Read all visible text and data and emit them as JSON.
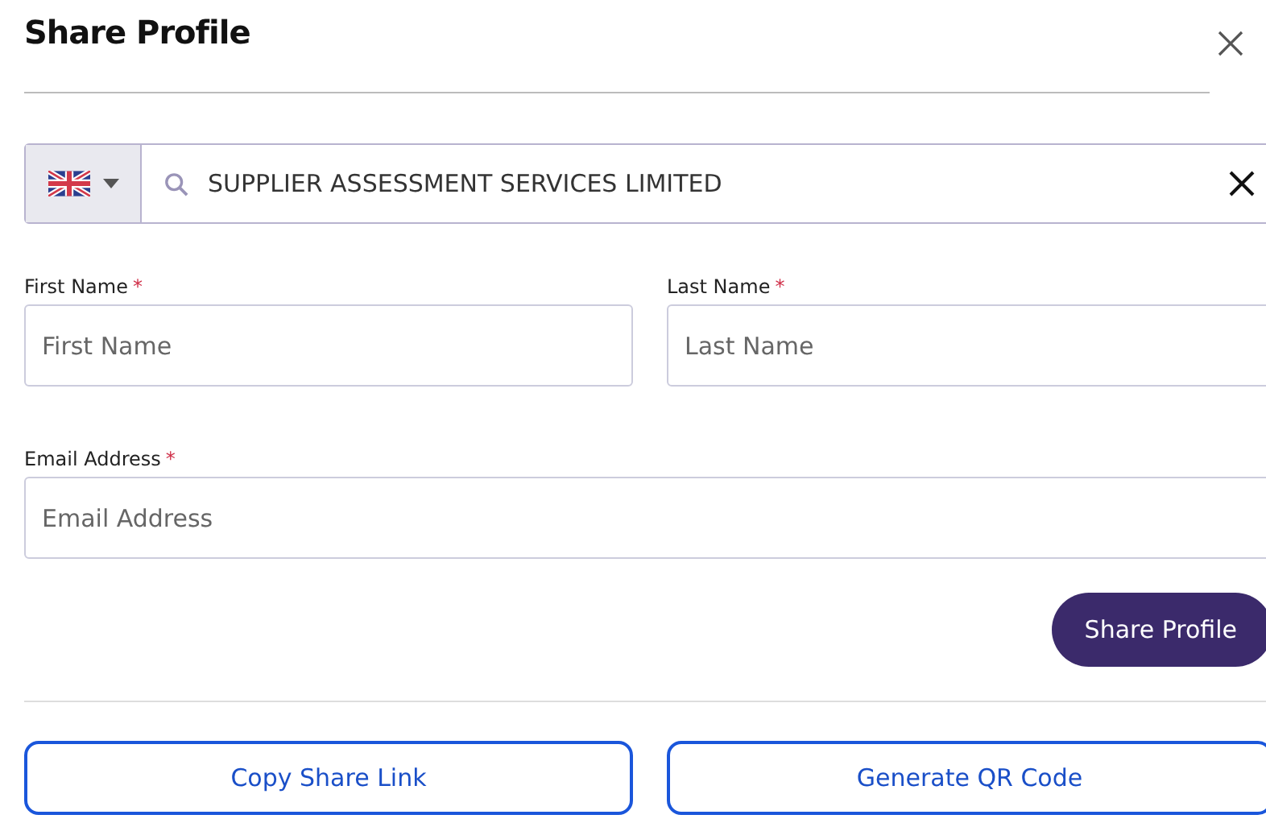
{
  "dialog": {
    "title": "Share Profile"
  },
  "search": {
    "value": "SUPPLIER ASSESSMENT SERVICES LIMITED"
  },
  "fields": [
    {
      "label": "First Name",
      "required_mark": "*",
      "placeholder": "First Name"
    },
    {
      "label": "Last Name",
      "required_mark": "*",
      "placeholder": "Last Name"
    },
    {
      "label": "Email Address",
      "required_mark": "*",
      "placeholder": "Email Address"
    }
  ],
  "primary_button": "Share Profile",
  "secondary_buttons": [
    "Copy Share Link",
    "Generate QR Code"
  ]
}
